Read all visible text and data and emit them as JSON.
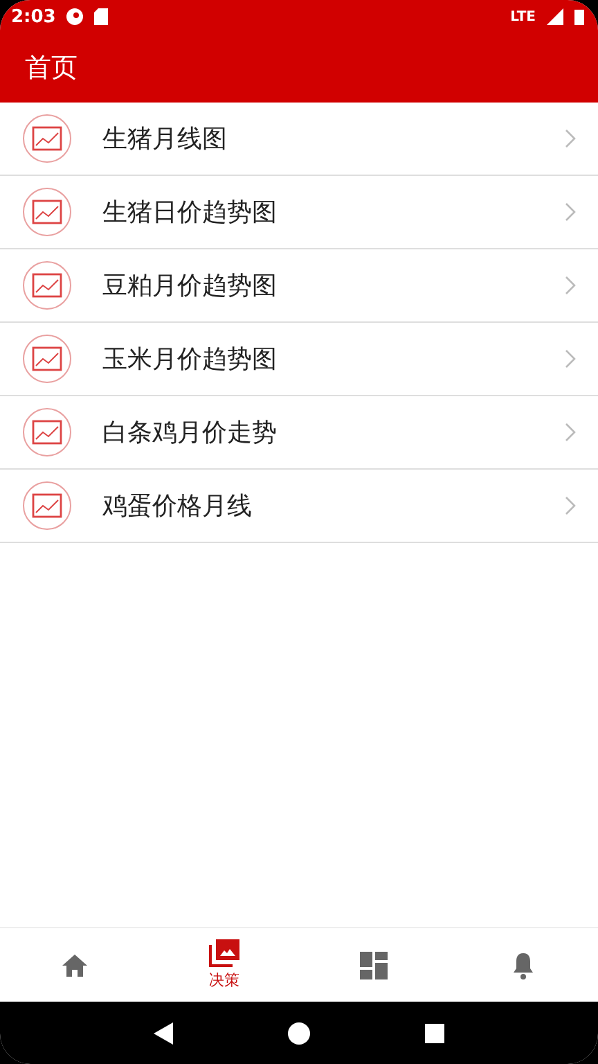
{
  "status_bar": {
    "time": "2:03",
    "network": "LTE"
  },
  "header": {
    "title": "首页"
  },
  "items": [
    {
      "label": "生猪月线图"
    },
    {
      "label": "生猪日价趋势图"
    },
    {
      "label": "豆粕月价趋势图"
    },
    {
      "label": "玉米月价趋势图"
    },
    {
      "label": "白条鸡月价走势"
    },
    {
      "label": "鸡蛋价格月线"
    }
  ],
  "bottom_nav": [
    {
      "kind": "home",
      "selected": false
    },
    {
      "kind": "image",
      "label": "决策",
      "selected": true
    },
    {
      "kind": "dashboard",
      "selected": false
    },
    {
      "kind": "bell",
      "selected": false
    }
  ]
}
